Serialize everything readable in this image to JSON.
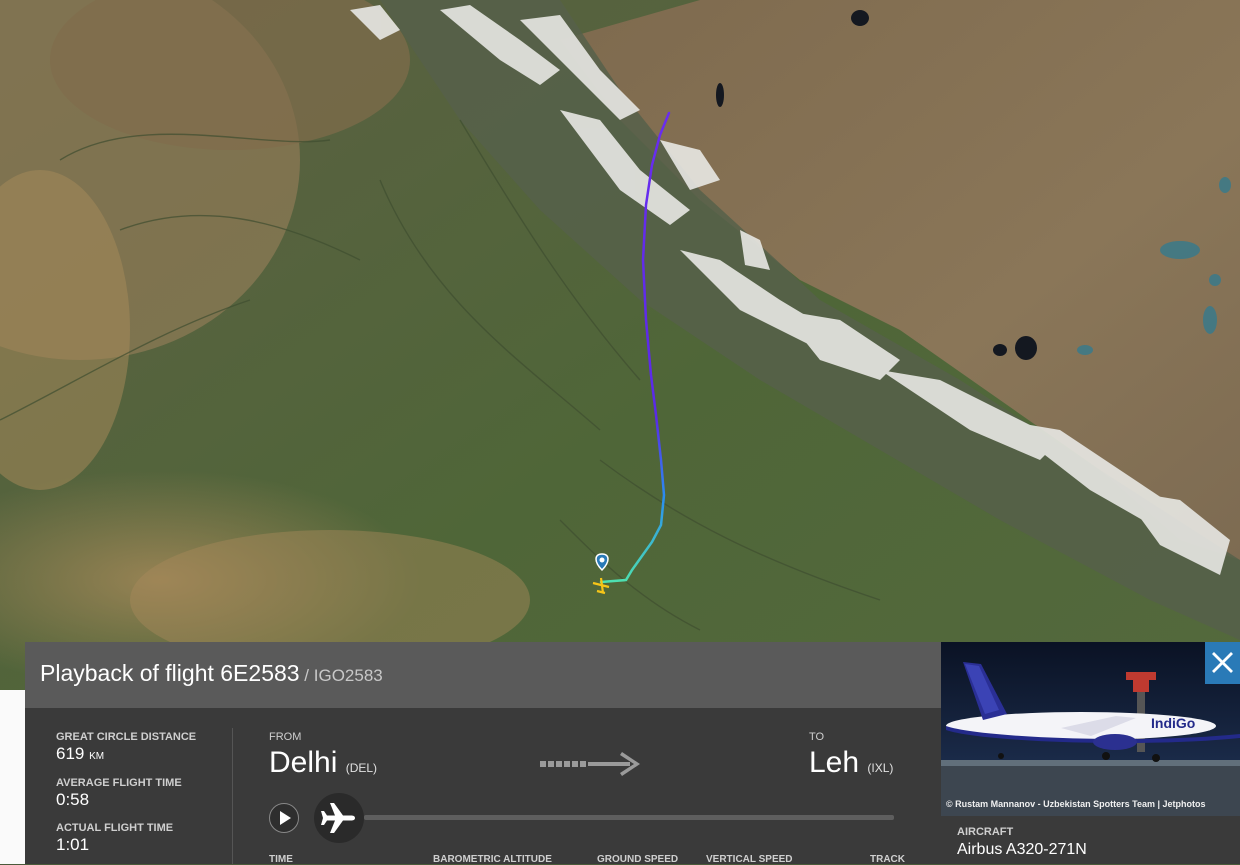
{
  "playback": {
    "title_prefix": "Playback of flight",
    "flight_number": "6E2583",
    "callsign": " / IGO2583"
  },
  "stats": {
    "distance_label": "GREAT CIRCLE DISTANCE",
    "distance_value": "619",
    "distance_unit": "KM",
    "avg_time_label": "AVERAGE FLIGHT TIME",
    "avg_time_value": "0:58",
    "actual_time_label": "ACTUAL FLIGHT TIME",
    "actual_time_value": "1:01"
  },
  "route": {
    "from_label": "FROM",
    "from_city": "Delhi",
    "from_code": "(DEL)",
    "to_label": "TO",
    "to_city": "Leh",
    "to_code": "(IXL)"
  },
  "columns": [
    "TIME",
    "BAROMETRIC ALTITUDE",
    "GROUND SPEED",
    "VERTICAL SPEED",
    "TRACK"
  ],
  "aircraft": {
    "label": "AIRCRAFT",
    "model": "Airbus A320-271N",
    "photo_credit": "© Rustam Mannanov - Uzbekistan Spotters Team | Jetphotos",
    "livery_text": "IndiGo"
  },
  "icons": {
    "play": "play-icon",
    "plane": "plane-icon",
    "close": "close-icon",
    "origin_marker": "map-pin-icon",
    "arrow": "route-arrow-icon"
  },
  "colors": {
    "panel": "#3a3a3a",
    "header": "#5a5a5a",
    "close_accent": "#2a7ab7",
    "track_start": "#4ee0b0",
    "track_mid": "#2a8ef0",
    "track_end": "#6a2cf0",
    "takeoff_marker": "#f5c518"
  }
}
